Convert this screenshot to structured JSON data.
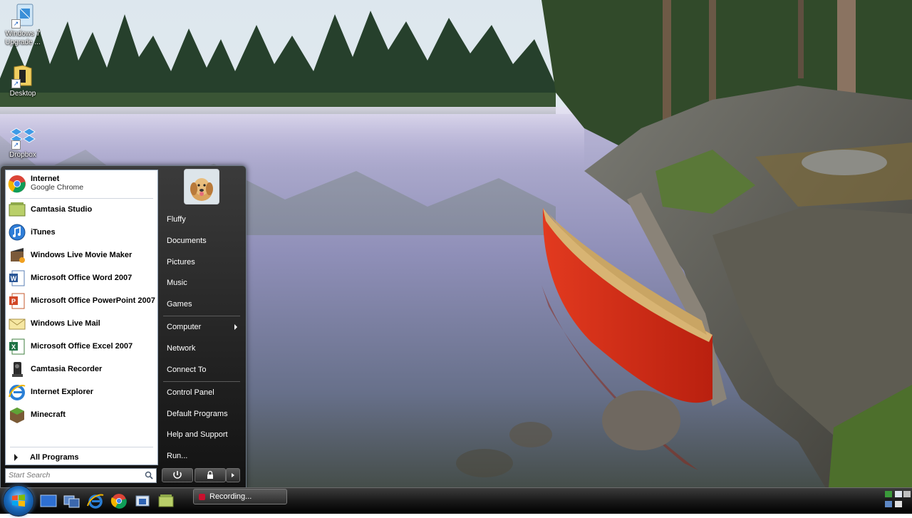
{
  "desktop": {
    "icons": [
      {
        "label": "Windows 7 Upgrade ..."
      },
      {
        "label": "Desktop"
      },
      {
        "label": "Dropbox"
      }
    ]
  },
  "start_menu": {
    "programs": [
      {
        "name": "Internet",
        "sub": "Google Chrome",
        "icon": "chrome-icon"
      },
      {
        "name": "Camtasia Studio",
        "icon": "camtasia-studio-icon"
      },
      {
        "name": "iTunes",
        "icon": "itunes-icon"
      },
      {
        "name": "Windows Live Movie Maker",
        "icon": "movie-maker-icon"
      },
      {
        "name": "Microsoft Office Word 2007",
        "icon": "word-icon"
      },
      {
        "name": "Microsoft Office PowerPoint 2007",
        "icon": "powerpoint-icon"
      },
      {
        "name": "Windows Live Mail",
        "icon": "live-mail-icon"
      },
      {
        "name": "Microsoft Office Excel 2007",
        "icon": "excel-icon"
      },
      {
        "name": "Camtasia Recorder",
        "icon": "camtasia-recorder-icon"
      },
      {
        "name": "Internet Explorer",
        "icon": "internet-explorer-icon"
      },
      {
        "name": "Minecraft",
        "icon": "minecraft-icon"
      }
    ],
    "all_programs": "All Programs",
    "search_placeholder": "Start Search",
    "right_items": [
      {
        "label": "Fluffy"
      },
      {
        "label": "Documents"
      },
      {
        "label": "Pictures"
      },
      {
        "label": "Music"
      },
      {
        "label": "Games"
      },
      {
        "label": "Computer"
      },
      {
        "label": "Network"
      },
      {
        "label": "Connect To"
      },
      {
        "label": "Control Panel"
      },
      {
        "label": "Default Programs"
      },
      {
        "label": "Help and Support"
      },
      {
        "label": "Run..."
      }
    ]
  },
  "taskbar": {
    "quick_launch": [
      "show-desktop-icon",
      "switch-windows-icon",
      "internet-explorer-icon",
      "chrome-icon",
      "windows-media-icon",
      "camtasia-studio-icon"
    ],
    "task_label": "Recording..."
  }
}
